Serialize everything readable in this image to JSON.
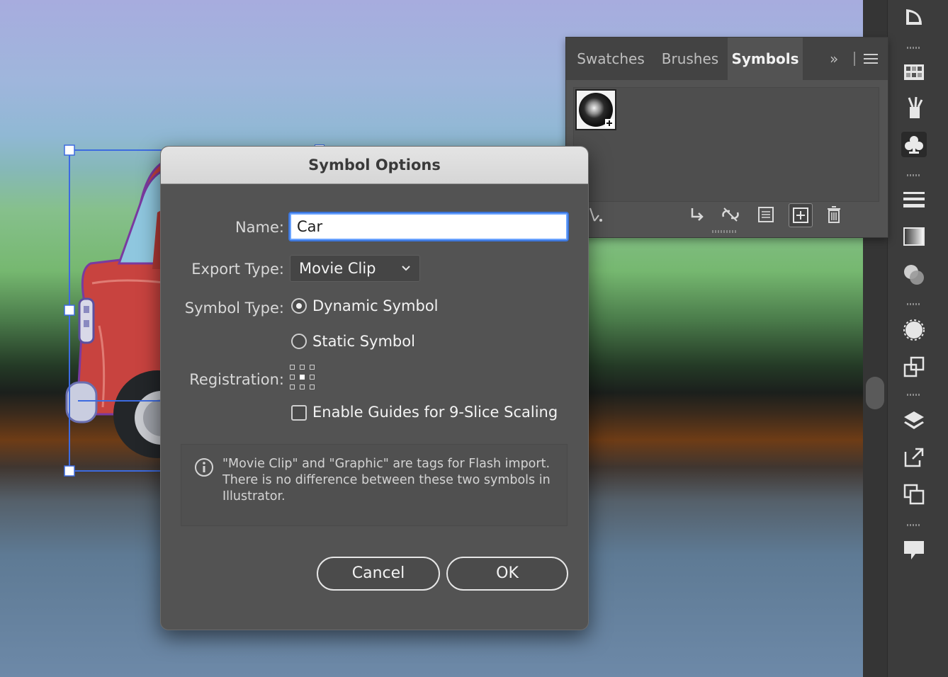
{
  "panel": {
    "tabs": [
      {
        "label": "Swatches",
        "active": false
      },
      {
        "label": "Brushes",
        "active": false
      },
      {
        "label": "Symbols",
        "active": true
      }
    ],
    "overflow_label": "»",
    "footer_buttons": [
      "symbol-libraries-menu-icon",
      "place-symbol-instance-icon",
      "break-link-icon",
      "symbol-options-icon",
      "new-symbol-icon",
      "delete-symbol-icon"
    ]
  },
  "dialog": {
    "title": "Symbol Options",
    "name_label": "Name:",
    "name_value": "Car",
    "export_type_label": "Export Type:",
    "export_type_value": "Movie Clip",
    "symbol_type_label": "Symbol Type:",
    "symbol_type_options": [
      {
        "label": "Dynamic Symbol",
        "selected": true
      },
      {
        "label": "Static Symbol",
        "selected": false
      }
    ],
    "registration_label": "Registration:",
    "nine_slice_label": "Enable Guides for 9-Slice Scaling",
    "nine_slice_checked": false,
    "info_text": "\"Movie Clip\" and \"Graphic\" are tags for Flash import. There is no difference between these two symbols in Illustrator.",
    "cancel_label": "Cancel",
    "ok_label": "OK"
  },
  "toolbar_icons": [
    "gradient-tool-icon",
    "swatches-icon",
    "brushes-icon",
    "symbols-icon",
    "stroke-icon",
    "gradient-icon",
    "transparency-icon",
    "appearance-icon",
    "graphic-styles-icon",
    "layers-icon",
    "export-icon",
    "artboards-icon",
    "comments-icon"
  ],
  "colors": {
    "dialog_bg": "#535353",
    "accent_focus": "#3b74d8",
    "selection_blue": "#3d6be0",
    "car_red": "#c8433f"
  }
}
